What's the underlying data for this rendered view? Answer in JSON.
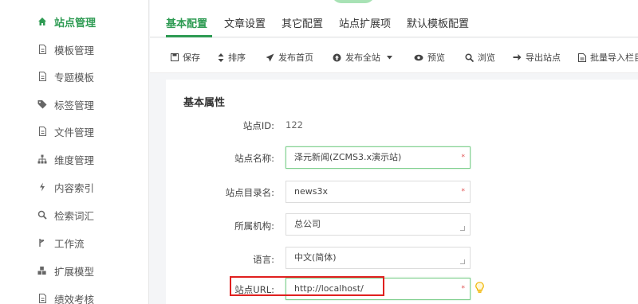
{
  "sidebar": {
    "items": [
      {
        "label": "站点管理",
        "icon": "home-icon",
        "active": true
      },
      {
        "label": "模板管理",
        "icon": "document-icon"
      },
      {
        "label": "专题模板",
        "icon": "document-icon"
      },
      {
        "label": "标签管理",
        "icon": "tag-icon"
      },
      {
        "label": "文件管理",
        "icon": "document-icon"
      },
      {
        "label": "维度管理",
        "icon": "sitemap-icon"
      },
      {
        "label": "内容索引",
        "icon": "bolt-icon"
      },
      {
        "label": "检索词汇",
        "icon": "search-icon"
      },
      {
        "label": "工作流",
        "icon": "workflow-icon"
      },
      {
        "label": "扩展模型",
        "icon": "cubes-icon"
      },
      {
        "label": "绩效考核",
        "icon": "document-icon"
      }
    ]
  },
  "tabs": [
    "基本配置",
    "文章设置",
    "其它配置",
    "站点扩展项",
    "默认模板配置"
  ],
  "toolbar": {
    "save": "保存",
    "sort": "排序",
    "publish_home": "发布首页",
    "publish_site": "发布全站",
    "preview": "预览",
    "browse": "浏览",
    "export_site": "导出站点",
    "batch_import": "批量导入栏目"
  },
  "form": {
    "section_title": "基本属性",
    "site_id_label": "站点ID:",
    "site_id_value": "122",
    "site_name_label": "站点名称:",
    "site_name_value": "泽元新闻(ZCMS3.x演示站)",
    "site_dir_label": "站点目录名:",
    "site_dir_value": "news3x",
    "org_label": "所属机构:",
    "org_value": "总公司",
    "lang_label": "语言:",
    "lang_value": "中文(简体)",
    "url_label": "站点URL:",
    "url_value": "http://localhost/",
    "required_mark": "*"
  },
  "colors": {
    "accent": "#2e9b53",
    "highlight": "#e0201f"
  }
}
